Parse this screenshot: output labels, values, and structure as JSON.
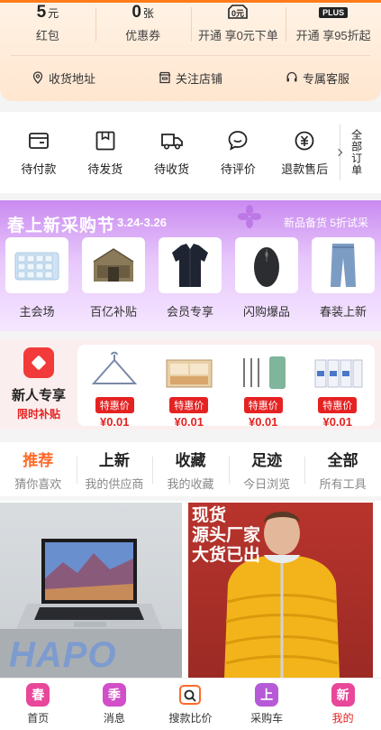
{
  "stats": [
    {
      "value": "5",
      "unit": "元",
      "label": "红包"
    },
    {
      "value": "0",
      "unit": "张",
      "label": "优惠券"
    },
    {
      "label": "开通 享0元下单",
      "icon": "zero-yuan-badge-icon",
      "icon_text": "0元"
    },
    {
      "label": "开通 享95折起",
      "icon": "plus-badge-icon",
      "icon_text": "PLUS"
    }
  ],
  "links": [
    {
      "label": "收货地址",
      "icon": "location-icon"
    },
    {
      "label": "关注店铺",
      "icon": "store-icon"
    },
    {
      "label": "专属客服",
      "icon": "headset-icon"
    }
  ],
  "orders": [
    {
      "label": "待付款",
      "icon": "wallet-icon"
    },
    {
      "label": "待发货",
      "icon": "package-icon"
    },
    {
      "label": "待收货",
      "icon": "truck-icon"
    },
    {
      "label": "待评价",
      "icon": "comment-icon"
    },
    {
      "label": "退款售后",
      "icon": "refund-icon"
    }
  ],
  "all_orders": "全部订单",
  "promo": {
    "title": "春上新采购节",
    "date": "3.24-3.26",
    "subtitle": "新品备货 5折试采",
    "items": [
      {
        "label": "主会场"
      },
      {
        "label": "百亿补贴"
      },
      {
        "label": "会员专享"
      },
      {
        "label": "闪购爆品"
      },
      {
        "label": "春装上新"
      }
    ]
  },
  "new_user": {
    "title": "新人专享",
    "subtitle": "限时补贴",
    "items": [
      {
        "tag": "特惠价",
        "price": "¥0.01"
      },
      {
        "tag": "特惠价",
        "price": "¥0.01"
      },
      {
        "tag": "特惠价",
        "price": "¥0.01"
      },
      {
        "tag": "特惠价",
        "price": "¥0.01"
      }
    ]
  },
  "tabs": [
    {
      "title": "推荐",
      "sub": "猜你喜欢",
      "active": true
    },
    {
      "title": "上新",
      "sub": "我的供应商"
    },
    {
      "title": "收藏",
      "sub": "我的收藏"
    },
    {
      "title": "足迹",
      "sub": "今日浏览"
    },
    {
      "title": "全部",
      "sub": "所有工具"
    }
  ],
  "products": {
    "p1_watermark": "HAPO",
    "p2_text": [
      "现货",
      "源头厂家",
      "大货已出"
    ]
  },
  "bottom_nav": [
    {
      "char": "春",
      "label": "首页",
      "color": "#e8479a"
    },
    {
      "char": "季",
      "label": "消息",
      "color": "#d24fc9"
    },
    {
      "char": "",
      "label": "搜款比价",
      "color": "#ff6a2a"
    },
    {
      "char": "上",
      "label": "采购车",
      "color": "#b65ad8"
    },
    {
      "char": "新",
      "label": "我的",
      "color": "#e8479a"
    }
  ],
  "colors": {
    "accent": "#ff6a2a",
    "price_red": "#e52222",
    "promo_purple": "#c98af0"
  }
}
